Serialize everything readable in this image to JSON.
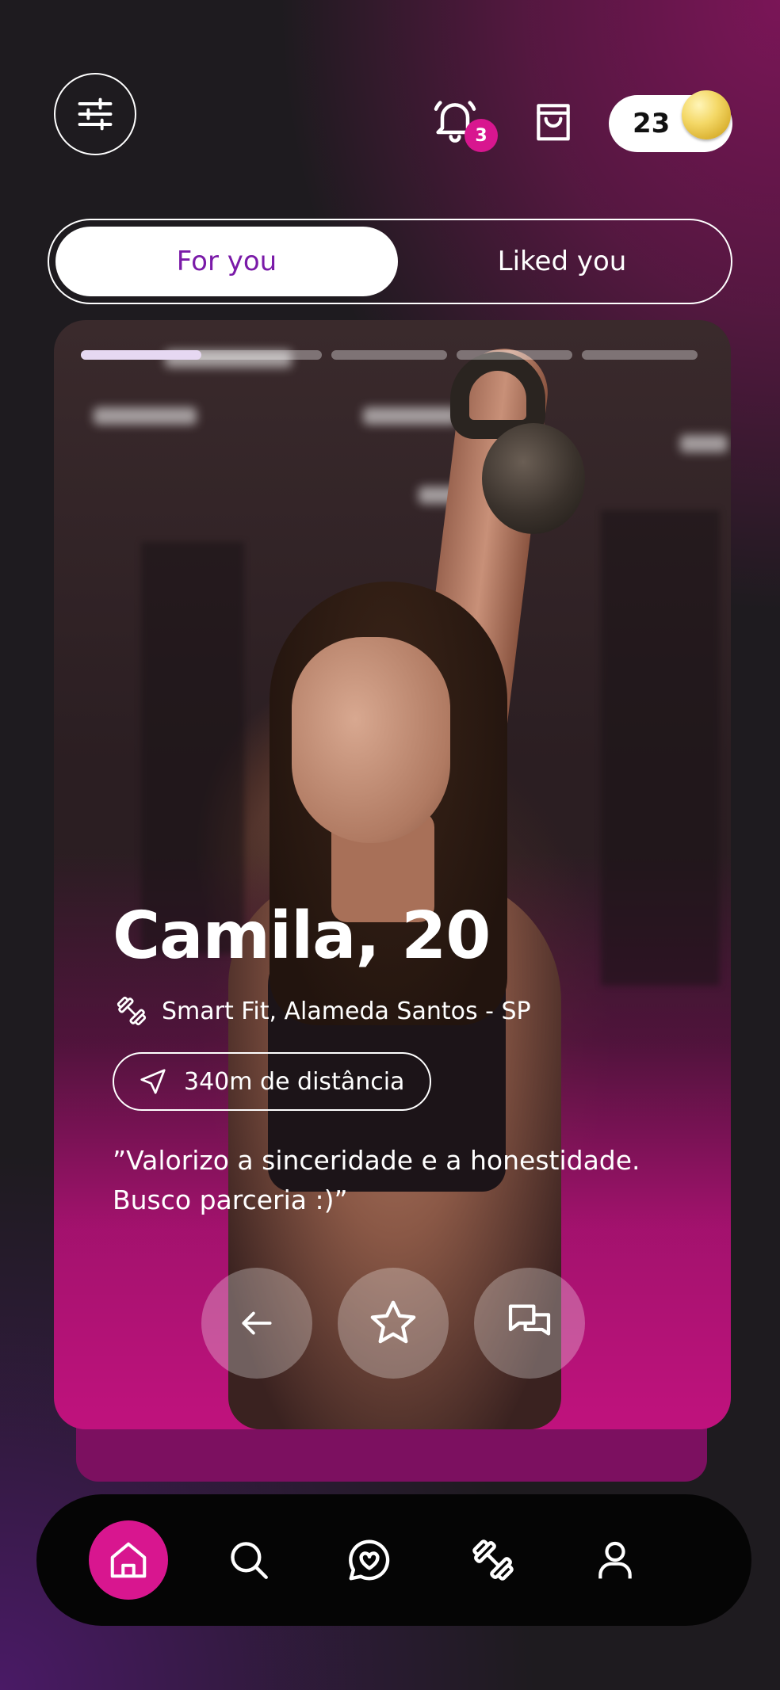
{
  "header": {
    "filter_icon": "sliders-icon",
    "notifications": {
      "icon": "bell-icon",
      "badge_count": "3"
    },
    "shop_icon": "shopping-bag-icon",
    "coins": {
      "count": "23",
      "icon": "coin-icon"
    }
  },
  "tabs": [
    {
      "label": "For you",
      "active": true
    },
    {
      "label": "Liked you",
      "active": false
    }
  ],
  "card": {
    "photo_progress": {
      "total_photos": 5,
      "current_photo": 1,
      "current_fill": 0.5
    },
    "name_age": "Camila, 20",
    "gym": {
      "icon": "dumbbell-icon",
      "label": "Smart Fit, Alameda Santos - SP"
    },
    "distance": {
      "icon": "navigation-arrow-icon",
      "label": "340m de distância"
    },
    "bio": "”Valorizo a sinceridade e a honestidade. Busco parceria :)”",
    "actions": [
      {
        "icon": "arrow-left-icon",
        "name": "back"
      },
      {
        "icon": "star-icon",
        "name": "favorite"
      },
      {
        "icon": "chat-bubbles-icon",
        "name": "message"
      }
    ]
  },
  "bottom_nav": [
    {
      "icon": "home-icon",
      "active": true
    },
    {
      "icon": "search-icon",
      "active": false
    },
    {
      "icon": "heart-chat-icon",
      "active": false
    },
    {
      "icon": "dumbbell-icon",
      "active": false
    },
    {
      "icon": "user-icon",
      "active": false
    }
  ],
  "colors": {
    "accent_pink": "#d8168f",
    "tab_active_text": "#7a1aa8",
    "background": "#1e1b1f"
  }
}
